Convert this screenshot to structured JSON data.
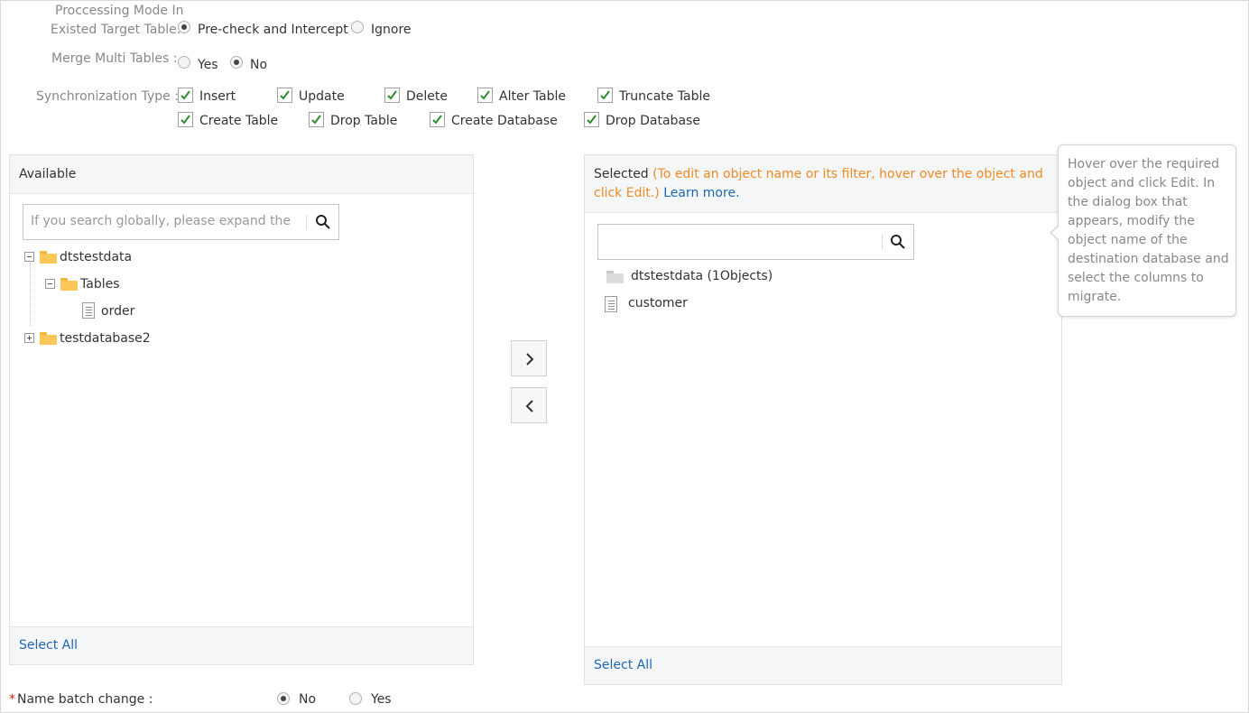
{
  "processing_mode": {
    "label_line1": "Proccessing Mode In",
    "label_line2": "Existed Target Table:",
    "options": [
      {
        "label": "Pre-check and Intercept",
        "selected": true
      },
      {
        "label": "Ignore",
        "selected": false
      }
    ]
  },
  "merge_multi_tables": {
    "label": "Merge Multi Tables :",
    "options": [
      {
        "label": "Yes",
        "selected": false
      },
      {
        "label": "No",
        "selected": true
      }
    ]
  },
  "sync_type": {
    "label": "Synchronization Type :",
    "options": [
      {
        "label": "Insert",
        "checked": true
      },
      {
        "label": "Update",
        "checked": true
      },
      {
        "label": "Delete",
        "checked": true
      },
      {
        "label": "Alter Table",
        "checked": true
      },
      {
        "label": "Truncate Table",
        "checked": true
      },
      {
        "label": "Create Table",
        "checked": true
      },
      {
        "label": "Drop Table",
        "checked": true
      },
      {
        "label": "Create Database",
        "checked": true
      },
      {
        "label": "Drop Database",
        "checked": true
      }
    ]
  },
  "available": {
    "title": "Available",
    "search_placeholder": "If you search globally, please expand the",
    "tree": {
      "db1": "dtstestdata",
      "tables_folder": "Tables",
      "table1": "order",
      "db2": "testdatabase2"
    },
    "select_all": "Select All"
  },
  "selected": {
    "title": "Selected",
    "hint": "(To edit an object name or its filter, hover over the object and click Edit.)",
    "learn_more": "Learn more.",
    "search_placeholder": "",
    "tree": {
      "db": "dtstestdata (1Objects)",
      "table": "customer"
    },
    "select_all": "Select All"
  },
  "tooltip": {
    "text": "Hover over the required object and click Edit. In the dialog box that appears, modify the object name of the destination database and select the columns to migrate."
  },
  "name_batch_change": {
    "required_mark": "*",
    "label": "Name batch change :",
    "options": [
      {
        "label": "No",
        "selected": true
      },
      {
        "label": "Yes",
        "selected": false
      }
    ]
  },
  "colors": {
    "link": "#1e66b4",
    "hint_orange": "#f08a24",
    "check_green": "#2e8b2e",
    "required_red": "#e02020"
  },
  "icons": [
    "search-icon",
    "collapse-icon",
    "expand-icon",
    "folder-icon",
    "table-icon",
    "chevron-right-icon",
    "chevron-left-icon",
    "checkmark-icon"
  ]
}
